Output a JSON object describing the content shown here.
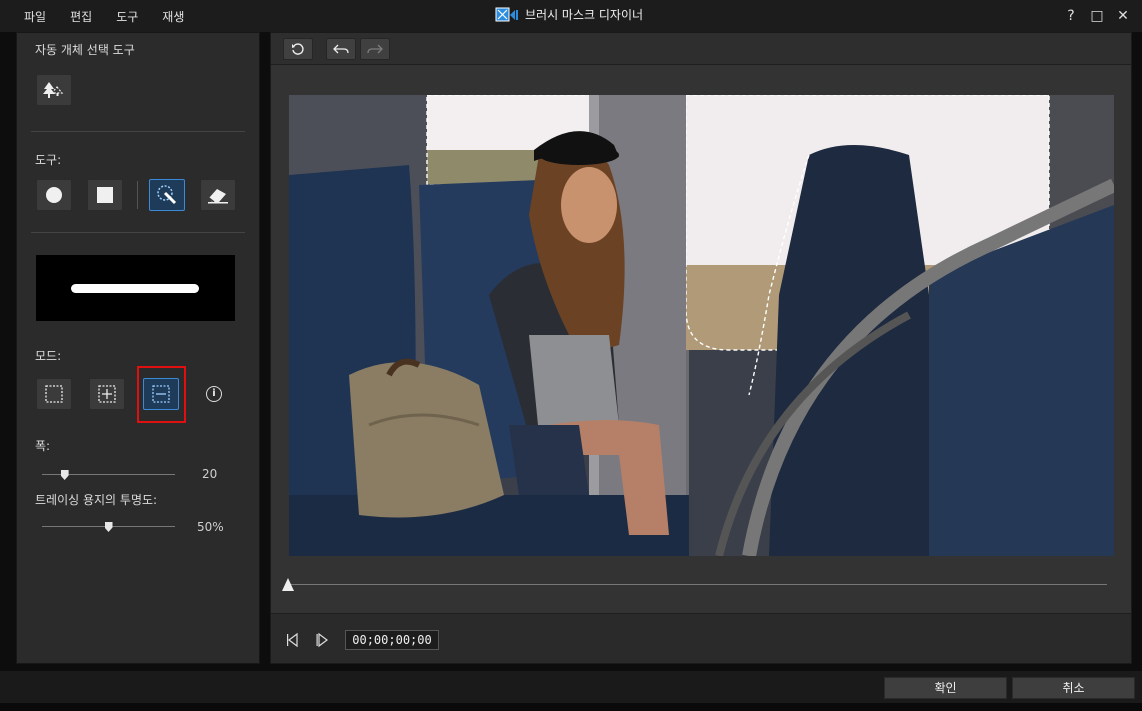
{
  "menu": [
    "파일",
    "편집",
    "도구",
    "재생"
  ],
  "window": {
    "title": "브러시 마스크 디자이너",
    "help": "?",
    "maximize": "□",
    "close": "✕"
  },
  "left": {
    "auto_select_label": "자동 개체 선택 도구",
    "tools_label": "도구:",
    "tools": [
      {
        "icon": "circle-brush-icon",
        "active": false
      },
      {
        "icon": "square-brush-icon",
        "active": false
      },
      {
        "icon": "smart-brush-icon",
        "active": true
      },
      {
        "icon": "eraser-icon",
        "active": false
      }
    ],
    "mode_label": "모드:",
    "modes": [
      {
        "icon": "select-mode-icon",
        "active": false
      },
      {
        "icon": "add-mode-icon",
        "active": false
      },
      {
        "icon": "subtract-mode-icon",
        "active": true
      }
    ],
    "info": "i",
    "width_label": "폭:",
    "width_value": "20",
    "width_fraction": 0.17,
    "opacity_label": "트레이싱 용지의 투명도:",
    "opacity_value": "50%",
    "opacity_fraction": 0.5
  },
  "player": {
    "timecode": "00;00;00;00",
    "timeline_fraction": 0.0
  },
  "footer": {
    "ok": "확인",
    "cancel": "취소"
  },
  "colors": {
    "accent": "#3a8ad8",
    "highlight": "#e01010",
    "panel": "#2b2b2b"
  }
}
